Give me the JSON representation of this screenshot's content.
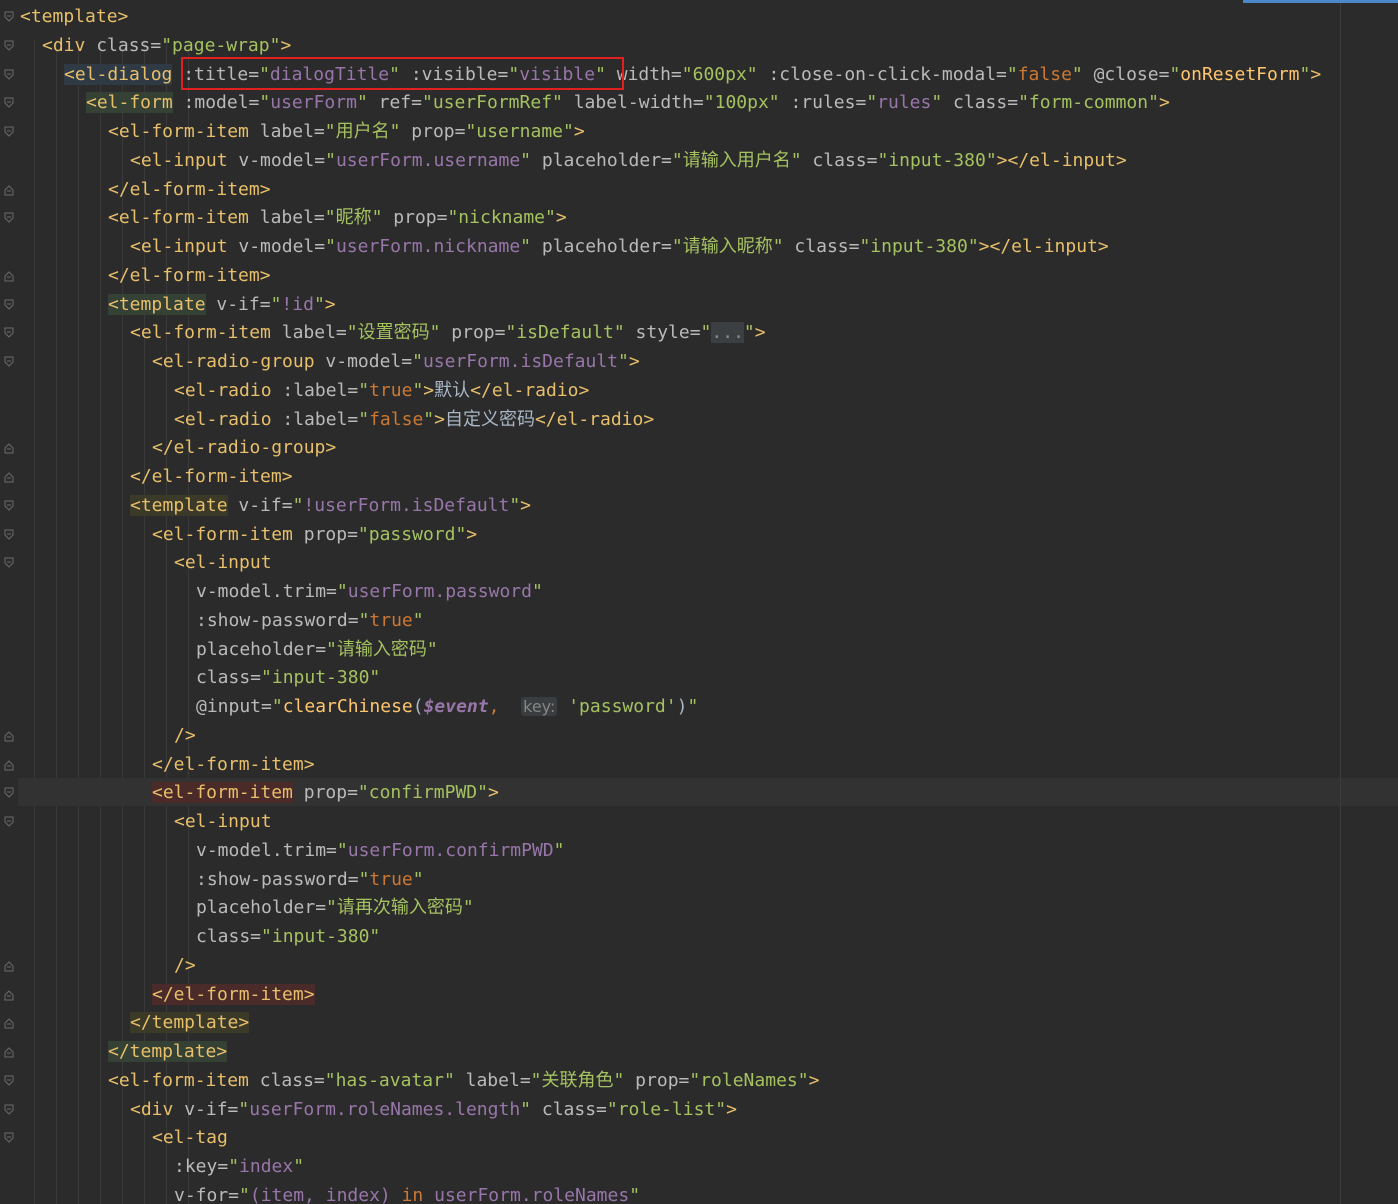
{
  "lines": [
    {
      "indent": 0,
      "fold": "open",
      "tokens": [
        {
          "t": "<template>",
          "c": "tag"
        }
      ]
    },
    {
      "indent": 1,
      "fold": "open",
      "tokens": [
        {
          "t": "<div",
          "c": "tag"
        },
        {
          "t": " class=",
          "c": "attr"
        },
        {
          "t": "\"page-wrap\"",
          "c": "val"
        },
        {
          "t": ">",
          "c": "tag"
        }
      ]
    },
    {
      "indent": 2,
      "fold": "open",
      "tokens": [
        {
          "t": "<el-dialog",
          "c": "tag",
          "bg": "blue"
        },
        {
          "t": " :title=",
          "c": "attr"
        },
        {
          "t": "\"",
          "c": "val"
        },
        {
          "t": "dialogTitle",
          "c": "exp"
        },
        {
          "t": "\"",
          "c": "val"
        },
        {
          "t": " :visible=",
          "c": "attr"
        },
        {
          "t": "\"",
          "c": "val"
        },
        {
          "t": "visible",
          "c": "exp"
        },
        {
          "t": "\"",
          "c": "val"
        },
        {
          "t": " width=",
          "c": "attr"
        },
        {
          "t": "\"600px\"",
          "c": "val"
        },
        {
          "t": " :close-on-click-modal=",
          "c": "attr"
        },
        {
          "t": "\"",
          "c": "val"
        },
        {
          "t": "false",
          "c": "lit"
        },
        {
          "t": "\"",
          "c": "val"
        },
        {
          "t": " @close=",
          "c": "attr"
        },
        {
          "t": "\"",
          "c": "val"
        },
        {
          "t": "onResetForm",
          "c": "fn"
        },
        {
          "t": "\"",
          "c": "val"
        },
        {
          "t": ">",
          "c": "tag"
        }
      ]
    },
    {
      "indent": 3,
      "fold": "open",
      "tokens": [
        {
          "t": "<el-form",
          "c": "tag",
          "bg": "green"
        },
        {
          "t": " :model=",
          "c": "attr"
        },
        {
          "t": "\"",
          "c": "val"
        },
        {
          "t": "userForm",
          "c": "exp"
        },
        {
          "t": "\"",
          "c": "val"
        },
        {
          "t": " ref=",
          "c": "attr"
        },
        {
          "t": "\"userFormRef\"",
          "c": "val"
        },
        {
          "t": " label-width=",
          "c": "attr"
        },
        {
          "t": "\"100px\"",
          "c": "val"
        },
        {
          "t": " :rules=",
          "c": "attr"
        },
        {
          "t": "\"",
          "c": "val"
        },
        {
          "t": "rules",
          "c": "exp"
        },
        {
          "t": "\"",
          "c": "val"
        },
        {
          "t": " class=",
          "c": "attr"
        },
        {
          "t": "\"form-common\"",
          "c": "val"
        },
        {
          "t": ">",
          "c": "tag"
        }
      ]
    },
    {
      "indent": 4,
      "fold": "open",
      "tokens": [
        {
          "t": "<el-form-item",
          "c": "tag"
        },
        {
          "t": " label=",
          "c": "attr"
        },
        {
          "t": "\"用户名\"",
          "c": "val"
        },
        {
          "t": " prop=",
          "c": "attr"
        },
        {
          "t": "\"username\"",
          "c": "val"
        },
        {
          "t": ">",
          "c": "tag"
        }
      ]
    },
    {
      "indent": 5,
      "fold": "",
      "tokens": [
        {
          "t": "<el-input",
          "c": "tag"
        },
        {
          "t": " v-model=",
          "c": "attr"
        },
        {
          "t": "\"",
          "c": "val"
        },
        {
          "t": "userForm.username",
          "c": "exp"
        },
        {
          "t": "\"",
          "c": "val"
        },
        {
          "t": " placeholder=",
          "c": "attr"
        },
        {
          "t": "\"请输入用户名\"",
          "c": "val"
        },
        {
          "t": " class=",
          "c": "attr"
        },
        {
          "t": "\"input-380\"",
          "c": "val"
        },
        {
          "t": "></el-input>",
          "c": "tag"
        }
      ]
    },
    {
      "indent": 4,
      "fold": "close",
      "tokens": [
        {
          "t": "</el-form-item>",
          "c": "tag"
        }
      ]
    },
    {
      "indent": 4,
      "fold": "open",
      "tokens": [
        {
          "t": "<el-form-item",
          "c": "tag"
        },
        {
          "t": " label=",
          "c": "attr"
        },
        {
          "t": "\"昵称\"",
          "c": "val"
        },
        {
          "t": " prop=",
          "c": "attr"
        },
        {
          "t": "\"nickname\"",
          "c": "val"
        },
        {
          "t": ">",
          "c": "tag"
        }
      ]
    },
    {
      "indent": 5,
      "fold": "",
      "tokens": [
        {
          "t": "<el-input",
          "c": "tag"
        },
        {
          "t": " v-model=",
          "c": "attr"
        },
        {
          "t": "\"",
          "c": "val"
        },
        {
          "t": "userForm.nickname",
          "c": "exp"
        },
        {
          "t": "\"",
          "c": "val"
        },
        {
          "t": " placeholder=",
          "c": "attr"
        },
        {
          "t": "\"请输入昵称\"",
          "c": "val"
        },
        {
          "t": " class=",
          "c": "attr"
        },
        {
          "t": "\"input-380\"",
          "c": "val"
        },
        {
          "t": "></el-input>",
          "c": "tag"
        }
      ]
    },
    {
      "indent": 4,
      "fold": "close",
      "tokens": [
        {
          "t": "</el-form-item>",
          "c": "tag"
        }
      ]
    },
    {
      "indent": 4,
      "fold": "open",
      "tokens": [
        {
          "t": "<template",
          "c": "tag",
          "bg": "green"
        },
        {
          "t": " v-if=",
          "c": "attr"
        },
        {
          "t": "\"",
          "c": "val"
        },
        {
          "t": "!id",
          "c": "exp"
        },
        {
          "t": "\"",
          "c": "val"
        },
        {
          "t": ">",
          "c": "tag"
        }
      ]
    },
    {
      "indent": 5,
      "fold": "open",
      "tokens": [
        {
          "t": "<el-form-item",
          "c": "tag"
        },
        {
          "t": " label=",
          "c": "attr"
        },
        {
          "t": "\"设置密码\"",
          "c": "val"
        },
        {
          "t": " prop=",
          "c": "attr"
        },
        {
          "t": "\"isDefault\"",
          "c": "val"
        },
        {
          "t": " style=",
          "c": "attr"
        },
        {
          "t": "\"",
          "c": "val"
        },
        {
          "t": "...",
          "c": "ph"
        },
        {
          "t": "\"",
          "c": "val"
        },
        {
          "t": ">",
          "c": "tag"
        }
      ]
    },
    {
      "indent": 6,
      "fold": "open",
      "tokens": [
        {
          "t": "<el-radio-group",
          "c": "tag"
        },
        {
          "t": " v-model=",
          "c": "attr"
        },
        {
          "t": "\"",
          "c": "val"
        },
        {
          "t": "userForm.isDefault",
          "c": "exp"
        },
        {
          "t": "\"",
          "c": "val"
        },
        {
          "t": ">",
          "c": "tag"
        }
      ]
    },
    {
      "indent": 7,
      "fold": "",
      "tokens": [
        {
          "t": "<el-radio",
          "c": "tag"
        },
        {
          "t": " :label=",
          "c": "attr"
        },
        {
          "t": "\"",
          "c": "val"
        },
        {
          "t": "true",
          "c": "lit"
        },
        {
          "t": "\"",
          "c": "val"
        },
        {
          "t": ">",
          "c": "tag"
        },
        {
          "t": "默认",
          "c": "txt"
        },
        {
          "t": "</el-radio>",
          "c": "tag"
        }
      ]
    },
    {
      "indent": 7,
      "fold": "",
      "tokens": [
        {
          "t": "<el-radio",
          "c": "tag"
        },
        {
          "t": " :label=",
          "c": "attr"
        },
        {
          "t": "\"",
          "c": "val"
        },
        {
          "t": "false",
          "c": "lit"
        },
        {
          "t": "\"",
          "c": "val"
        },
        {
          "t": ">",
          "c": "tag"
        },
        {
          "t": "自定义密码",
          "c": "txt"
        },
        {
          "t": "</el-radio>",
          "c": "tag"
        }
      ]
    },
    {
      "indent": 6,
      "fold": "close",
      "tokens": [
        {
          "t": "</el-radio-group>",
          "c": "tag"
        }
      ]
    },
    {
      "indent": 5,
      "fold": "close",
      "tokens": [
        {
          "t": "</el-form-item>",
          "c": "tag"
        }
      ]
    },
    {
      "indent": 5,
      "fold": "open",
      "tokens": [
        {
          "t": "<template",
          "c": "tag",
          "bg": "yellow"
        },
        {
          "t": " v-if=",
          "c": "attr"
        },
        {
          "t": "\"",
          "c": "val"
        },
        {
          "t": "!userForm.isDefault",
          "c": "exp"
        },
        {
          "t": "\"",
          "c": "val"
        },
        {
          "t": ">",
          "c": "tag"
        }
      ]
    },
    {
      "indent": 6,
      "fold": "open",
      "tokens": [
        {
          "t": "<el-form-item",
          "c": "tag"
        },
        {
          "t": " prop=",
          "c": "attr"
        },
        {
          "t": "\"password\"",
          "c": "val"
        },
        {
          "t": ">",
          "c": "tag"
        }
      ]
    },
    {
      "indent": 7,
      "fold": "open",
      "tokens": [
        {
          "t": "<el-input",
          "c": "tag"
        }
      ]
    },
    {
      "indent": 8,
      "fold": "",
      "tokens": [
        {
          "t": "v-model.trim=",
          "c": "attr"
        },
        {
          "t": "\"",
          "c": "val"
        },
        {
          "t": "userForm.password",
          "c": "exp"
        },
        {
          "t": "\"",
          "c": "val"
        }
      ]
    },
    {
      "indent": 8,
      "fold": "",
      "tokens": [
        {
          "t": ":show-password=",
          "c": "attr"
        },
        {
          "t": "\"",
          "c": "val"
        },
        {
          "t": "true",
          "c": "lit"
        },
        {
          "t": "\"",
          "c": "val"
        }
      ]
    },
    {
      "indent": 8,
      "fold": "",
      "tokens": [
        {
          "t": "placeholder=",
          "c": "attr"
        },
        {
          "t": "\"请输入密码\"",
          "c": "val"
        }
      ]
    },
    {
      "indent": 8,
      "fold": "",
      "tokens": [
        {
          "t": "class=",
          "c": "attr"
        },
        {
          "t": "\"input-380\"",
          "c": "val"
        }
      ]
    },
    {
      "indent": 8,
      "fold": "",
      "tokens": [
        {
          "t": "@input=",
          "c": "attr"
        },
        {
          "t": "\"",
          "c": "val"
        },
        {
          "t": "clearChinese",
          "c": "fn"
        },
        {
          "t": "(",
          "c": "txt"
        },
        {
          "t": "$event",
          "c": "evt"
        },
        {
          "t": ",  ",
          "c": "lit"
        },
        {
          "t": "key:",
          "c": "hint"
        },
        {
          "t": " ",
          "c": "txt"
        },
        {
          "t": "'password'",
          "c": "val"
        },
        {
          "t": ")",
          "c": "txt"
        },
        {
          "t": "\"",
          "c": "val"
        }
      ]
    },
    {
      "indent": 7,
      "fold": "close",
      "tokens": [
        {
          "t": "/>",
          "c": "tag"
        }
      ]
    },
    {
      "indent": 6,
      "fold": "close",
      "tokens": [
        {
          "t": "</el-form-item>",
          "c": "tag"
        }
      ]
    },
    {
      "indent": 6,
      "fold": "open",
      "current": true,
      "tokens": [
        {
          "t": "<el-form-item",
          "c": "tag",
          "bg": "red"
        },
        {
          "t": " prop=",
          "c": "attr"
        },
        {
          "t": "\"confirmPWD\"",
          "c": "val"
        },
        {
          "t": ">",
          "c": "tag"
        }
      ]
    },
    {
      "indent": 7,
      "fold": "open",
      "tokens": [
        {
          "t": "<el-input",
          "c": "tag"
        }
      ]
    },
    {
      "indent": 8,
      "fold": "",
      "tokens": [
        {
          "t": "v-model.trim=",
          "c": "attr"
        },
        {
          "t": "\"",
          "c": "val"
        },
        {
          "t": "userForm.confirmPWD",
          "c": "exp"
        },
        {
          "t": "\"",
          "c": "val"
        }
      ]
    },
    {
      "indent": 8,
      "fold": "",
      "tokens": [
        {
          "t": ":show-password=",
          "c": "attr"
        },
        {
          "t": "\"",
          "c": "val"
        },
        {
          "t": "true",
          "c": "lit"
        },
        {
          "t": "\"",
          "c": "val"
        }
      ]
    },
    {
      "indent": 8,
      "fold": "",
      "tokens": [
        {
          "t": "placeholder=",
          "c": "attr"
        },
        {
          "t": "\"请再次输入密码\"",
          "c": "val"
        }
      ]
    },
    {
      "indent": 8,
      "fold": "",
      "tokens": [
        {
          "t": "class=",
          "c": "attr"
        },
        {
          "t": "\"input-380\"",
          "c": "val"
        }
      ]
    },
    {
      "indent": 7,
      "fold": "close",
      "tokens": [
        {
          "t": "/>",
          "c": "tag"
        }
      ]
    },
    {
      "indent": 6,
      "fold": "close",
      "tokens": [
        {
          "t": "</el-form-item>",
          "c": "tag",
          "bg": "red"
        }
      ]
    },
    {
      "indent": 5,
      "fold": "close",
      "tokens": [
        {
          "t": "</template>",
          "c": "tag",
          "bg": "yellow"
        }
      ]
    },
    {
      "indent": 4,
      "fold": "close",
      "tokens": [
        {
          "t": "</template>",
          "c": "tag",
          "bg": "green"
        }
      ]
    },
    {
      "indent": 4,
      "fold": "open",
      "tokens": [
        {
          "t": "<el-form-item",
          "c": "tag"
        },
        {
          "t": " class=",
          "c": "attr"
        },
        {
          "t": "\"has-avatar\"",
          "c": "val"
        },
        {
          "t": " label=",
          "c": "attr"
        },
        {
          "t": "\"关联角色\"",
          "c": "val"
        },
        {
          "t": " prop=",
          "c": "attr"
        },
        {
          "t": "\"roleNames\"",
          "c": "val"
        },
        {
          "t": ">",
          "c": "tag"
        }
      ]
    },
    {
      "indent": 5,
      "fold": "open",
      "tokens": [
        {
          "t": "<div",
          "c": "tag"
        },
        {
          "t": " v-if=",
          "c": "attr"
        },
        {
          "t": "\"",
          "c": "val"
        },
        {
          "t": "userForm.roleNames.length",
          "c": "exp"
        },
        {
          "t": "\"",
          "c": "val"
        },
        {
          "t": " class=",
          "c": "attr"
        },
        {
          "t": "\"role-list\"",
          "c": "val"
        },
        {
          "t": ">",
          "c": "tag"
        }
      ]
    },
    {
      "indent": 6,
      "fold": "open",
      "tokens": [
        {
          "t": "<el-tag",
          "c": "tag"
        }
      ]
    },
    {
      "indent": 7,
      "fold": "",
      "tokens": [
        {
          "t": ":key=",
          "c": "attr"
        },
        {
          "t": "\"",
          "c": "val"
        },
        {
          "t": "index",
          "c": "exp"
        },
        {
          "t": "\"",
          "c": "val"
        }
      ]
    },
    {
      "indent": 7,
      "fold": "",
      "tokens": [
        {
          "t": "v-for=",
          "c": "attr"
        },
        {
          "t": "\"",
          "c": "val"
        },
        {
          "t": "(item, index) ",
          "c": "exp"
        },
        {
          "t": "in",
          "c": "lit"
        },
        {
          "t": " userForm.roleNames",
          "c": "exp"
        },
        {
          "t": "\"",
          "c": "val"
        }
      ]
    }
  ],
  "colors": {
    "background": "#2b2b2b",
    "tag": "#e8bf6a",
    "attribute": "#bababa",
    "string": "#a5c261",
    "expression": "#9876aa",
    "keyword": "#cc7832",
    "function": "#ffc66d",
    "highlight_box": "#e32020"
  },
  "highlight": {
    "label": "title-visible-attrs-highlight"
  }
}
